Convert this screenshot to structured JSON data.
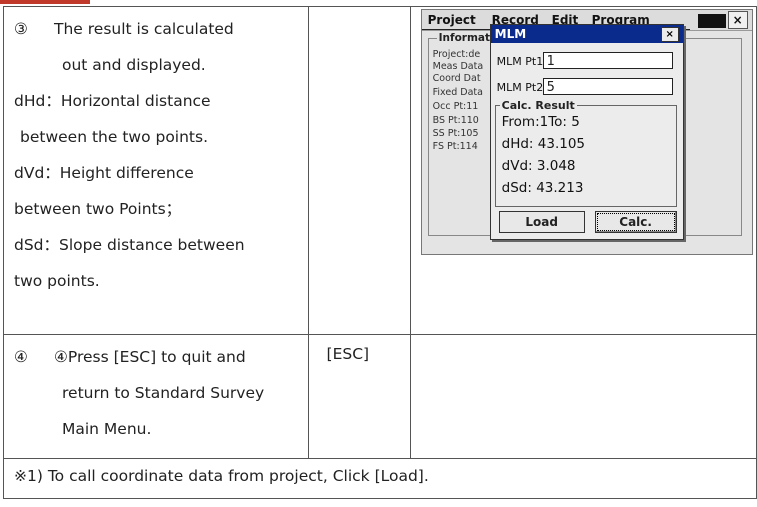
{
  "step3": {
    "number": "③",
    "lines": [
      "The result is calculated",
      "out and displayed.",
      "dHd：Horizontal distance",
      "between the two points.",
      "dVd：Height difference",
      "between two Points；",
      "dSd：Slope distance between",
      "two points."
    ]
  },
  "step4": {
    "number": "④",
    "lines": [
      "④Press [ESC] to quit and",
      "return to Standard Survey",
      "Main Menu."
    ],
    "key": "[ESC]"
  },
  "note": "※1) To call coordinate data from project, Click [Load].",
  "screen": {
    "menu": [
      "Project",
      "Record",
      "Edit",
      "Program"
    ],
    "close": "×",
    "info_title": "Informat",
    "info_lines": [
      "Project:de",
      "Meas Data",
      "Coord Dat",
      "Fixed Data",
      "Occ Pt:11",
      "BS Pt:110",
      "SS Pt:105",
      "FS Pt:114"
    ],
    "dialog": {
      "title": "MLM",
      "close": "×",
      "pt1_label": "MLM  Pt1",
      "pt1_value": "1",
      "pt2_label": "MLM  Pt2",
      "pt2_value": "5",
      "result_title": "Calc. Result",
      "result_lines": [
        "From:1To: 5",
        "dHd: 43.105",
        "dVd: 3.048",
        "dSd: 43.213"
      ],
      "load_label": "Load",
      "calc_label": "Calc."
    }
  }
}
